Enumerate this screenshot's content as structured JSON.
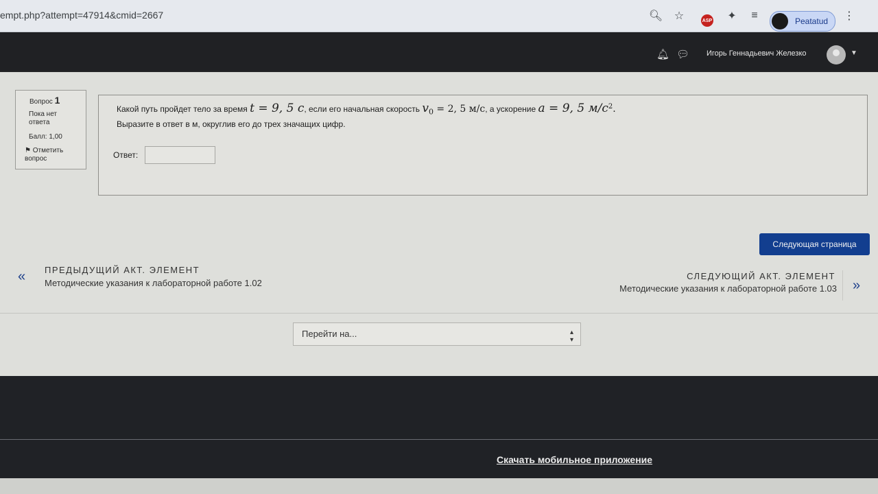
{
  "browser": {
    "url": "empt.php?attempt=47914&cmid=2667",
    "profile_label": "Peatatud",
    "asp_label": "ASP"
  },
  "navbar": {
    "user_name": "Игорь Геннадьевич Железко"
  },
  "question_info": {
    "label": "Вопрос",
    "number": "1",
    "status": "Пока нет ответа",
    "score": "Балл: 1,00",
    "flag_label": "Отметить вопрос"
  },
  "question": {
    "part1": "Какой путь пройдет тело за время ",
    "t_var": "t = 9, 5 с",
    "part2": ", если его начальная скорость ",
    "v_var": "v",
    "v_sub": "0",
    "v_value": " = 2, 5 м/с",
    "part3": ", а ускорение ",
    "a_var": "a = 9, 5 м/с",
    "a_sup": "2",
    "end": ".",
    "line2": "Выразите в ответ в м, округлив  его до трех значащих цифр.",
    "answer_label": "Ответ:",
    "answer_value": ""
  },
  "actions": {
    "next_page": "Следующая страница"
  },
  "activity_nav": {
    "prev_heading": "ПРЕДЫДУЩИЙ АКТ. ЭЛЕМЕНТ",
    "prev_link": "Методические указания к лабораторной работе 1.02",
    "next_heading": "СЛЕДУЮЩИЙ АКТ. ЭЛЕМЕНТ",
    "next_link": "Методические указания к лабораторной работе 1.03"
  },
  "jump": {
    "placeholder": "Перейти на..."
  },
  "footer": {
    "mobile_link": "Скачать мобильное приложение"
  }
}
